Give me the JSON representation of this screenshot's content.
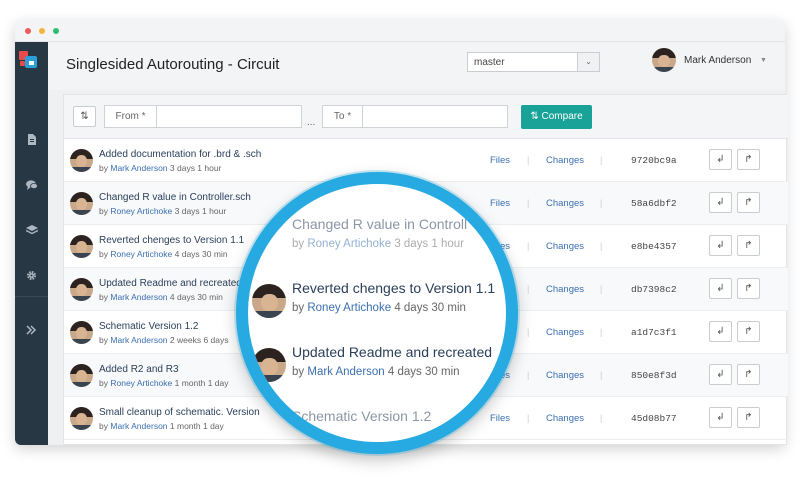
{
  "window": {
    "traffic_colors": [
      "#ef5a5a",
      "#f4b33f",
      "#2dbb6e"
    ]
  },
  "sidebar": {
    "icons": [
      "file-icon",
      "chat-icon",
      "layers-icon",
      "gear-icon",
      "expand-icon"
    ]
  },
  "header": {
    "title": "Singlesided Autorouting - Circuit",
    "branch": "master",
    "user_name": "Mark Anderson"
  },
  "toolbar": {
    "from_label": "From *",
    "to_label": "To *",
    "dots": "...",
    "compare_label": "Compare",
    "accent": "#19a398"
  },
  "commits": [
    {
      "title": "Added documentation for .brd & .sch",
      "author": "Mark Anderson",
      "time": "3 days 1 hour",
      "files": "Files",
      "changes": "Changes",
      "hash": "9720bc9a"
    },
    {
      "title": "Changed R value in Controller.sch",
      "author": "Roney Artichoke",
      "time": "3 days 1 hour",
      "files": "Files",
      "changes": "Changes",
      "hash": "58a6dbf2"
    },
    {
      "title": "Reverted chenges to Version 1.1",
      "author": "Roney Artichoke",
      "time": "4 days 30 min",
      "files": "Files",
      "changes": "Changes",
      "hash": "e8be4357"
    },
    {
      "title": "Updated Readme and recreated",
      "author": "Mark Anderson",
      "time": "4 days 30 min",
      "files": "Files",
      "changes": "Changes",
      "hash": "db7398c2"
    },
    {
      "title": "Schematic Version 1.2",
      "author": "Mark Anderson",
      "time": "2 weeks 6 days",
      "files": "Files",
      "changes": "Changes",
      "hash": "a1d7c3f1"
    },
    {
      "title": "Added R2 and R3",
      "author": "Roney Artichoke",
      "time": "1 month 1 day",
      "files": "Files",
      "changes": "Changes",
      "hash": "850e8f3d"
    },
    {
      "title": "Small cleanup of schematic. Version",
      "author": "Mark Anderson",
      "time": "1 month 1 day",
      "files": "Files",
      "changes": "Changes",
      "hash": "45d08b77"
    }
  ],
  "by_label": "by",
  "separator": "|",
  "magnifier": {
    "rows": [
      {
        "title": "Changed R value in Controll",
        "author": "Roney Artichoke",
        "time": "3 days 1 hour"
      },
      {
        "title": "Reverted chenges to Version 1.1",
        "author": "Roney Artichoke",
        "time": "4 days 30 min"
      },
      {
        "title": "Updated Readme and recreated",
        "author": "Mark Anderson",
        "time": "4 days 30 min"
      },
      {
        "title": "Schematic Version 1.2",
        "author": "",
        "time": ""
      }
    ],
    "ring_color": "#27aae1"
  }
}
